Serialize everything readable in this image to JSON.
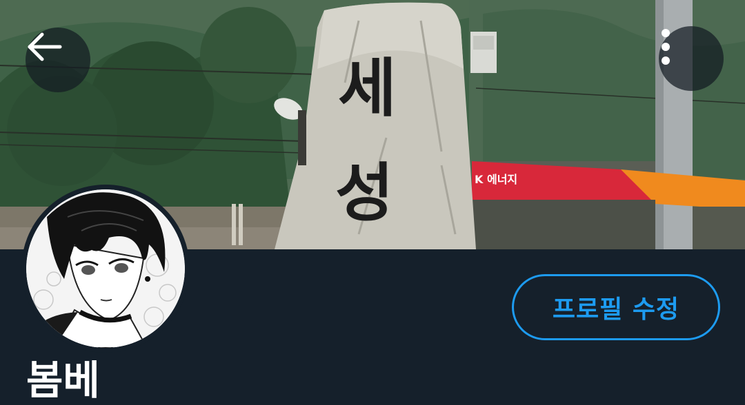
{
  "header": {
    "back_button": {
      "icon": "arrow-left-icon"
    },
    "more_button": {
      "icon": "more-vertical-icon"
    },
    "banner": {
      "stone_text_line1": "세",
      "stone_text_line2": "성",
      "store_sign_text": "K 에너지"
    }
  },
  "profile": {
    "display_name": "봄베",
    "edit_button_label": "프로필 수정",
    "avatar_icon": "avatar-illustration"
  },
  "colors": {
    "background": "#15202b",
    "accent": "#1d9bf0",
    "text": "#ffffff",
    "store_red": "#d8283a",
    "store_orange": "#f08a1e"
  }
}
